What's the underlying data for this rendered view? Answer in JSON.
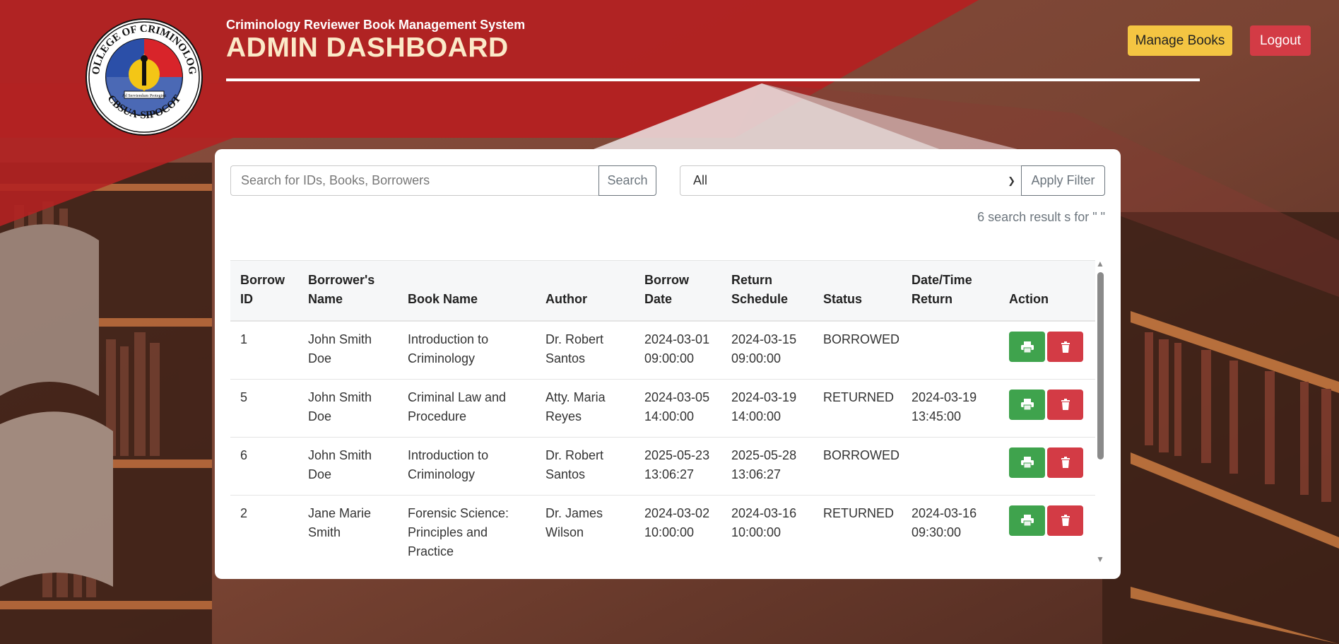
{
  "header": {
    "subtitle": "Criminology Reviewer Book Management System",
    "title": "ADMIN DASHBOARD",
    "manage_books_label": "Manage Books",
    "logout_label": "Logout"
  },
  "logo": {
    "text_top": "COLLEGE OF CRIMINOLOGY",
    "text_bottom": "CBSUA-SIPOCOT",
    "motto": "Ad Serviendum Protegimi"
  },
  "search": {
    "placeholder": "Search for IDs, Books, Borrowers",
    "button_label": "Search"
  },
  "filter": {
    "selected": "All",
    "apply_label": "Apply Filter"
  },
  "result_text": "6 search result s for \" \"",
  "table": {
    "headers": {
      "borrow_id": "Borrow ID",
      "borrower": "Borrower's Name",
      "book": "Book Name",
      "author": "Author",
      "borrow_date": "Borrow Date",
      "return_schedule": "Return Schedule",
      "status": "Status",
      "date_return": "Date/Time Return",
      "action": "Action"
    },
    "rows": [
      {
        "id": "1",
        "borrower": "John Smith Doe",
        "book": "Introduction to Criminology",
        "author": "Dr. Robert Santos",
        "borrow_date": "2024-03-01 09:00:00",
        "return_schedule": "2024-03-15 09:00:00",
        "status": "BORROWED",
        "date_return": ""
      },
      {
        "id": "5",
        "borrower": "John Smith Doe",
        "book": "Criminal Law and Procedure",
        "author": "Atty. Maria Reyes",
        "borrow_date": "2024-03-05 14:00:00",
        "return_schedule": "2024-03-19 14:00:00",
        "status": "RETURNED",
        "date_return": "2024-03-19 13:45:00"
      },
      {
        "id": "6",
        "borrower": "John Smith Doe",
        "book": "Introduction to Criminology",
        "author": "Dr. Robert Santos",
        "borrow_date": "2025-05-23 13:06:27",
        "return_schedule": "2025-05-28 13:06:27",
        "status": "BORROWED",
        "date_return": ""
      },
      {
        "id": "2",
        "borrower": "Jane Marie Smith",
        "book": "Forensic Science: Principles and Practice",
        "author": "Dr. James Wilson",
        "borrow_date": "2024-03-02 10:00:00",
        "return_schedule": "2024-03-16 10:00:00",
        "status": "RETURNED",
        "date_return": "2024-03-16 09:30:00"
      }
    ]
  },
  "icons": {
    "print": "print-icon",
    "delete": "trash-icon",
    "scroll_up": "arrow-up-icon",
    "scroll_down": "arrow-down-icon"
  },
  "colors": {
    "brand_red": "#b22222",
    "manage_yellow": "#f4c542",
    "logout_red": "#d33b45",
    "print_green": "#3fa34d"
  }
}
